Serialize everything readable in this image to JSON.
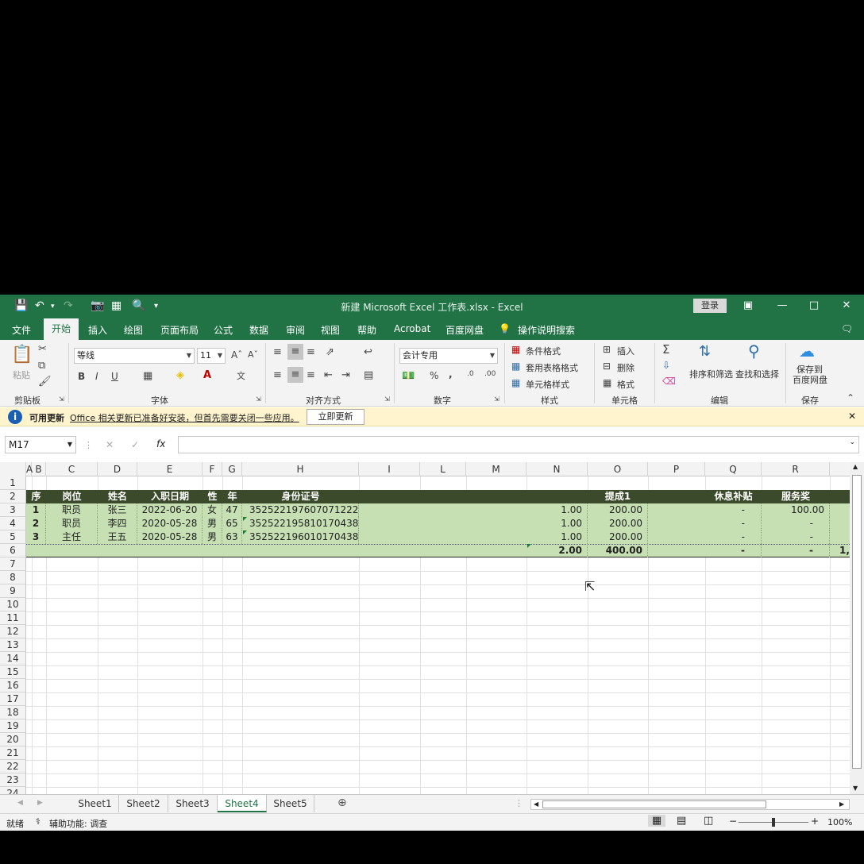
{
  "window": {
    "title": "新建 Microsoft Excel 工作表.xlsx  -  Excel",
    "login": "登录"
  },
  "ribbon_tabs": [
    "文件",
    "开始",
    "插入",
    "绘图",
    "页面布局",
    "公式",
    "数据",
    "审阅",
    "视图",
    "帮助",
    "Acrobat",
    "百度网盘",
    "操作说明搜索"
  ],
  "ribbon": {
    "paste": "粘贴",
    "font_name": "等线",
    "font_size": "11",
    "number_format": "会计专用",
    "cond_format": "条件格式",
    "table_format": "套用表格格式",
    "cell_style": "单元格样式",
    "insert": "插入",
    "delete": "删除",
    "format": "格式",
    "sort_filter": "排序和筛选",
    "find_select": "查找和选择",
    "save_to": "保存到",
    "baidu_disk": "百度网盘",
    "groups": {
      "clipboard": "剪贴板",
      "font": "字体",
      "align": "对齐方式",
      "number": "数字",
      "styles": "样式",
      "cells": "单元格",
      "editing": "编辑",
      "save": "保存"
    }
  },
  "infobar": {
    "title": "可用更新",
    "message": "Office 相关更新已准备好安装，但首先需要关闭一些应用。",
    "button": "立即更新"
  },
  "formula_bar": {
    "name_box": "M17",
    "formula": ""
  },
  "columns": [
    "A",
    "B",
    "C",
    "D",
    "E",
    "F",
    "G",
    "H",
    "I",
    "L",
    "M",
    "N",
    "O",
    "P",
    "Q",
    "R"
  ],
  "rows": [
    "1",
    "2",
    "3",
    "4",
    "5",
    "6",
    "7",
    "8",
    "9",
    "10",
    "11",
    "12",
    "13",
    "14",
    "15",
    "16",
    "17",
    "18",
    "19",
    "20",
    "21",
    "22",
    "23",
    "24"
  ],
  "table": {
    "headers": {
      "seq": "序",
      "post": "岗位",
      "name": "姓名",
      "date": "入职日期",
      "sex": "性",
      "age": "年",
      "id": "身份证号",
      "o": "提成1",
      "q": "休息补贴",
      "r": "服务奖"
    },
    "records": [
      {
        "seq": "1",
        "post": "职员",
        "name": "张三",
        "date": "2022-06-20",
        "sex": "女",
        "age": "47",
        "id": "352522197607071222",
        "n": "1.00",
        "o": "200.00",
        "q": "-",
        "r": "100.00"
      },
      {
        "seq": "2",
        "post": "职员",
        "name": "李四",
        "date": "2020-05-28",
        "sex": "男",
        "age": "65",
        "id": "352522195810170438",
        "n": "1.00",
        "o": "200.00",
        "q": "-",
        "r": "-"
      },
      {
        "seq": "3",
        "post": "主任",
        "name": "王五",
        "date": "2020-05-28",
        "sex": "男",
        "age": "63",
        "id": "352522196010170438",
        "n": "1.00",
        "o": "200.00",
        "q": "-",
        "r": "-"
      }
    ],
    "totals": {
      "n": "2.00",
      "o": "400.00",
      "q": "-",
      "r": "-",
      "s": "1,"
    }
  },
  "sheets": [
    "Sheet1",
    "Sheet2",
    "Sheet3",
    "Sheet4",
    "Sheet5"
  ],
  "active_sheet": "Sheet4",
  "status": {
    "ready": "就绪",
    "accessibility": "辅助功能: 调查",
    "zoom": "100%"
  },
  "colors": {
    "excel_green": "#217346",
    "header_fill": "#3a4a2a",
    "row_fill": "#c6e0b4"
  }
}
